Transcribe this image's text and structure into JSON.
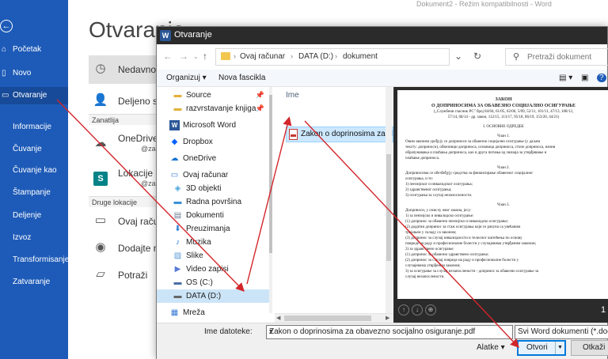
{
  "window_title": "Dokument2  -  Režim kompatibilnosti  -  Word",
  "backstage": {
    "back_icon": "back-arrow-icon",
    "heading": "Otvaranje",
    "nav": [
      {
        "label": "Početak",
        "icon": "home-icon"
      },
      {
        "label": "Novo",
        "icon": "new-doc-icon"
      },
      {
        "label": "Otvaranje",
        "icon": "open-folder-icon",
        "active": true
      }
    ],
    "nav_sub": [
      "Informacije",
      "Čuvanje",
      "Čuvanje kao",
      "Štampanje",
      "Deljenje",
      "Izvoz",
      "Transformisanje",
      "Zatvaranje"
    ],
    "locations": {
      "recent": "Nedavno",
      "shared": "Deljeno sa",
      "group_zanatlija": "Zanatlija",
      "onedrive": {
        "title": "OneDrive -",
        "sub": "@za"
      },
      "lokacije": {
        "title": "Lokacije -",
        "sub": "@za"
      },
      "group_other": "Druge lokacije",
      "this_pc": "Ovaj raču",
      "add_place": "Dodajte m",
      "browse": "Potraži"
    }
  },
  "dialog": {
    "title": "Otvaranje",
    "address": [
      "Ovaj računar",
      "DATA (D:)",
      "dokument"
    ],
    "search_placeholder": "Pretraži dokument",
    "toolbar": {
      "organize": "Organizuj",
      "new_folder": "Nova fascikla"
    },
    "nav_items": [
      {
        "label": "Source",
        "icon": "folder-icon",
        "pinned": true
      },
      {
        "label": "razvrstavanje knjiga",
        "icon": "folder-icon",
        "pinned": true
      },
      {
        "label": "Microsoft Word",
        "icon": "word-icon"
      },
      {
        "label": "Dropbox",
        "icon": "dropbox-icon"
      },
      {
        "label": "OneDrive",
        "icon": "onedrive-icon"
      },
      {
        "label": "Ovaj računar",
        "icon": "computer-icon"
      },
      {
        "label": "3D objekti",
        "icon": "3d-objects-icon"
      },
      {
        "label": "Radna površina",
        "icon": "desktop-icon"
      },
      {
        "label": "Dokumenti",
        "icon": "documents-icon"
      },
      {
        "label": "Preuzimanja",
        "icon": "downloads-icon"
      },
      {
        "label": "Muzika",
        "icon": "music-icon"
      },
      {
        "label": "Slike",
        "icon": "pictures-icon"
      },
      {
        "label": "Video zapisi",
        "icon": "videos-icon"
      },
      {
        "label": "OS (C:)",
        "icon": "drive-icon"
      },
      {
        "label": "DATA (D:)",
        "icon": "drive-icon",
        "selected": true
      },
      {
        "label": "Mreža",
        "icon": "network-icon"
      }
    ],
    "file_list": {
      "column_header": "Ime",
      "files": [
        "Zakon o doprinosima za obavezn"
      ]
    },
    "preview": {
      "lines": [
        {
          "t": "ЗАКОН",
          "s": "t1"
        },
        {
          "t": "О ДОПРИНОСИМА ЗА ОБАВЕЗНО СОЦИЈАЛНО ОСИГУРАЊЕ",
          "s": "t1"
        },
        {
          "t": "(„Службени гласник РС\" број 84/04, 61/05, 62/06, 5/09, 52/11, 101/11, 47/13, 108/13,",
          "s": "c"
        },
        {
          "t": "57/14, 68/14 - др. закон, 112/15, 113/17, 95/18, 86/19, 153/20, 44/21)",
          "s": "c"
        },
        {
          "t": "",
          "s": "sp"
        },
        {
          "t": "I. ОСНОВНЕ ОДРЕДБЕ",
          "s": "c"
        },
        {
          "t": "",
          "s": "sp"
        },
        {
          "t": "Члан 1.",
          "s": "c"
        },
        {
          "t": "Овим законом уређују се доприноси за обавезно социјално осигурање (у даљем",
          "s": "p"
        },
        {
          "t": "тексту: доприноси), обвезници доприноса, основица доприноса, стопе доприноса, начин",
          "s": "p"
        },
        {
          "t": "обрачунавања и плаћања доприноса, као и друга питања од значаја за утврђивање и",
          "s": "p"
        },
        {
          "t": "плаћање доприноса.",
          "s": "p"
        },
        {
          "t": "",
          "s": "sp"
        },
        {
          "t": "Члан 2.",
          "s": "c"
        },
        {
          "t": "Доприносима се обезбеђују средства за финансирање обавезног социјалног",
          "s": "p"
        },
        {
          "t": "осигурања, и то:",
          "s": "p"
        },
        {
          "t": "1) пензијског и инвалидског осигурања;",
          "s": "p"
        },
        {
          "t": "2) здравственог осигурања;",
          "s": "p"
        },
        {
          "t": "3) осигурања за случај незапослености.",
          "s": "p"
        },
        {
          "t": "",
          "s": "sp"
        },
        {
          "t": "Члан 3.",
          "s": "c"
        },
        {
          "t": "Доприноси, у смислу овог закона, јесу:",
          "s": "p"
        },
        {
          "t": "1) за пензијско и инвалидско осигурање:",
          "s": "p"
        },
        {
          "t": "(1) допринос за обавезно пензијско и инвалидско осигурање;",
          "s": "p"
        },
        {
          "t": "(2) додатни допринос за стаж осигурања који се рачуна са увећаним",
          "s": "p"
        },
        {
          "t": "трајањем у складу са законом;",
          "s": "p"
        },
        {
          "t": "(3) допринос за случај инвалидности и телесног оштећења по основу",
          "s": "p"
        },
        {
          "t": "повреде на раду и професионалне болести у случајевима утврђеним законом;",
          "s": "p"
        },
        {
          "t": "2) за здравствено осигурање:",
          "s": "p"
        },
        {
          "t": "(1) допринос за обавезно здравствено осигурање;",
          "s": "p"
        },
        {
          "t": "(2) допринос за случај повреде на раду и професионалне болести у",
          "s": "p"
        },
        {
          "t": "случајевима утврђеним законом;",
          "s": "p"
        },
        {
          "t": "3) за осигурање за случај незапослености - допринос за обавезно осигурање за",
          "s": "p"
        },
        {
          "t": "случај незапослености.",
          "s": "p"
        }
      ],
      "page_number": "1"
    },
    "bottom": {
      "file_name_label": "Ime datoteke:",
      "file_name_value": "Zakon o doprinosima za obavezno socijalno osiguranje.pdf",
      "file_type": "Svi Word dokumenti (*.docx;*.d",
      "tools_label": "Alatke",
      "open_label": "Otvori",
      "cancel_label": "Otkaži"
    }
  },
  "colors": {
    "word_blue": "#1e5bb8",
    "arrow": "#d3262b",
    "select_blue": "#cce8ff"
  }
}
